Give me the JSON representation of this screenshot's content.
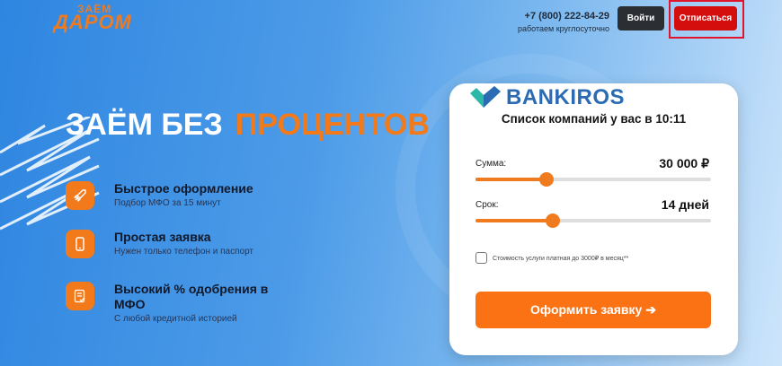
{
  "header": {
    "logo_top": "ЗАЁМ",
    "logo_main": "ДАРОМ",
    "phone": "+7 (800) 222-84-29",
    "hours": "работаем круглосуточно",
    "login_label": "Войти",
    "unsubscribe_label": "Отписаться"
  },
  "hero": {
    "title_white": "ЗАЁМ БЕЗ",
    "title_orange": "ПРОЦЕНТОВ",
    "features": [
      {
        "title": "Быстрое оформление",
        "subtitle": "Подбор МФО за 15 минут",
        "icon": "rocket-icon"
      },
      {
        "title": "Простая заявка",
        "subtitle": "Нужен только телефон и паспорт",
        "icon": "phone-icon"
      },
      {
        "title": "Высокий % одобрения в МФО",
        "subtitle": "С любой кредитной историей",
        "icon": "document-check-icon"
      }
    ]
  },
  "card": {
    "brand": "BANKIROS",
    "subtitle": "Список компаний у вас в 10:11",
    "amount": {
      "label": "Сумма:",
      "value": "30 000 ₽",
      "fraction": 0.3
    },
    "term": {
      "label": "Срок:",
      "value": "14 дней",
      "fraction": 0.33
    },
    "checkbox_label": "Стоимость услуги платная до 3000₽ в месяц**",
    "checkbox_checked": false,
    "apply_label": "Оформить заявку ➔"
  },
  "colors": {
    "accent": "#f07a1e",
    "danger": "#d40d0d",
    "brand": "#2b6bb3"
  }
}
